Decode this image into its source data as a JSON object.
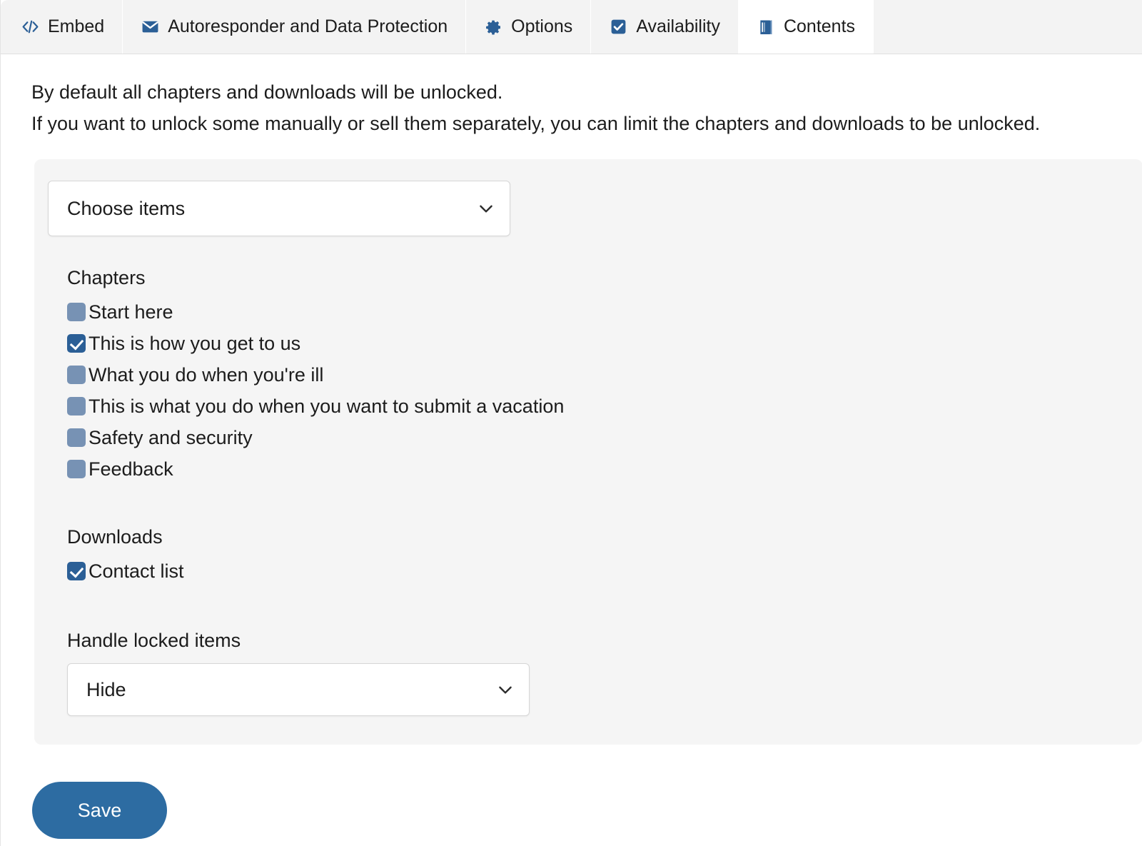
{
  "tabs": [
    {
      "id": "embed",
      "label": "Embed",
      "icon": "code-icon",
      "active": false
    },
    {
      "id": "autoresponder",
      "label": "Autoresponder and Data Protection",
      "icon": "envelope-icon",
      "active": false
    },
    {
      "id": "options",
      "label": "Options",
      "icon": "gear-icon",
      "active": false
    },
    {
      "id": "availability",
      "label": "Availability",
      "icon": "checkbox-icon",
      "active": false
    },
    {
      "id": "contents",
      "label": "Contents",
      "icon": "book-icon",
      "active": true
    }
  ],
  "intro": {
    "line1": "By default all chapters and downloads will be unlocked.",
    "line2": "If you want to unlock some manually or sell them separately, you can limit the chapters and downloads to be unlocked."
  },
  "choose_items": {
    "value": "Choose items",
    "options": [
      "Choose items"
    ]
  },
  "chapters": {
    "label": "Chapters",
    "items": [
      {
        "label": "Start here",
        "checked": false
      },
      {
        "label": "This is how you get to us",
        "checked": true
      },
      {
        "label": "What you do when you're ill",
        "checked": false
      },
      {
        "label": "This is what you do when you want to submit a vacation",
        "checked": false
      },
      {
        "label": "Safety and security",
        "checked": false
      },
      {
        "label": "Feedback",
        "checked": false
      }
    ]
  },
  "downloads": {
    "label": "Downloads",
    "items": [
      {
        "label": "Contact list",
        "checked": true
      }
    ]
  },
  "handle_locked": {
    "label": "Handle locked items",
    "value": "Hide",
    "options": [
      "Hide"
    ]
  },
  "save": {
    "label": "Save"
  },
  "colors": {
    "accent": "#2b5f96",
    "save_button": "#2d6ca2",
    "checkbox_unchecked": "#7792b4",
    "checkbox_checked": "#2b5f96",
    "card_background": "#f5f5f5",
    "tab_inactive_background": "#f3f3f3",
    "text": "#1c1c1c"
  }
}
